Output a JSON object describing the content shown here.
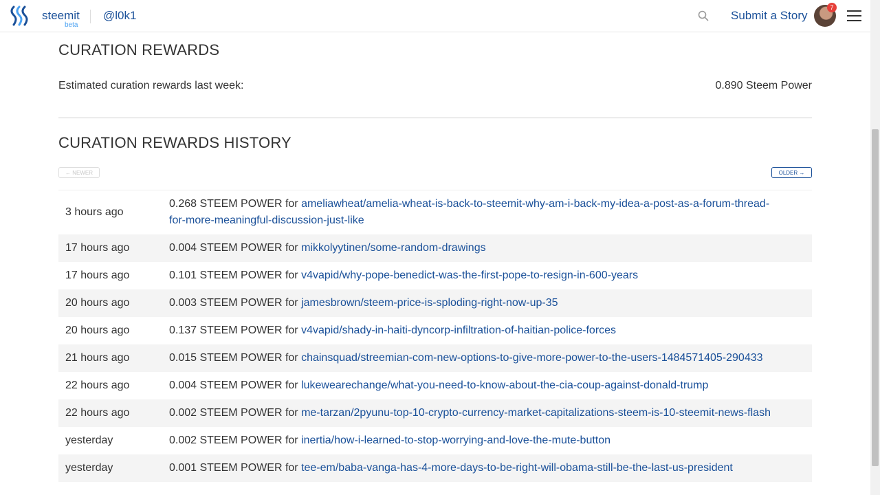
{
  "header": {
    "brand": "steemit",
    "beta": "beta",
    "username": "@l0k1",
    "submit_label": "Submit a Story",
    "notification_count": "7"
  },
  "curation": {
    "title": "CURATION REWARDS",
    "estimate_label": "Estimated curation rewards last week:",
    "estimate_value": "0.890 Steem Power"
  },
  "history": {
    "title": "CURATION REWARDS HISTORY",
    "newer_label": "← NEWER",
    "older_label": "OLDER →",
    "rows": [
      {
        "time": "3 hours ago",
        "amount": "0.268 STEEM POWER for ",
        "link": "ameliawheat/amelia-wheat-is-back-to-steemit-why-am-i-back-my-idea-a-post-as-a-forum-thread-for-more-meaningful-discussion-just-like"
      },
      {
        "time": "17 hours ago",
        "amount": "0.004 STEEM POWER for ",
        "link": "mikkolyytinen/some-random-drawings"
      },
      {
        "time": "17 hours ago",
        "amount": "0.101 STEEM POWER for ",
        "link": "v4vapid/why-pope-benedict-was-the-first-pope-to-resign-in-600-years"
      },
      {
        "time": "20 hours ago",
        "amount": "0.003 STEEM POWER for ",
        "link": "jamesbrown/steem-price-is-sploding-right-now-up-35"
      },
      {
        "time": "20 hours ago",
        "amount": "0.137 STEEM POWER for ",
        "link": "v4vapid/shady-in-haiti-dyncorp-infiltration-of-haitian-police-forces"
      },
      {
        "time": "21 hours ago",
        "amount": "0.015 STEEM POWER for ",
        "link": "chainsquad/streemian-com-new-options-to-give-more-power-to-the-users-1484571405-290433"
      },
      {
        "time": "22 hours ago",
        "amount": "0.004 STEEM POWER for ",
        "link": "lukewearechange/what-you-need-to-know-about-the-cia-coup-against-donald-trump"
      },
      {
        "time": "22 hours ago",
        "amount": "0.002 STEEM POWER for ",
        "link": "me-tarzan/2pyunu-top-10-crypto-currency-market-capitalizations-steem-is-10-steemit-news-flash"
      },
      {
        "time": "yesterday",
        "amount": "0.002 STEEM POWER for ",
        "link": "inertia/how-i-learned-to-stop-worrying-and-love-the-mute-button"
      },
      {
        "time": "yesterday",
        "amount": "0.001 STEEM POWER for ",
        "link": "tee-em/baba-vanga-has-4-more-days-to-be-right-will-obama-still-be-the-last-us-president"
      }
    ]
  },
  "colors": {
    "link": "#1a5099",
    "badge": "#e6403a",
    "stripe": "#f4f4f4"
  },
  "icons": [
    "steemit-logo-icon",
    "search-icon",
    "avatar",
    "hamburger-menu-icon"
  ]
}
